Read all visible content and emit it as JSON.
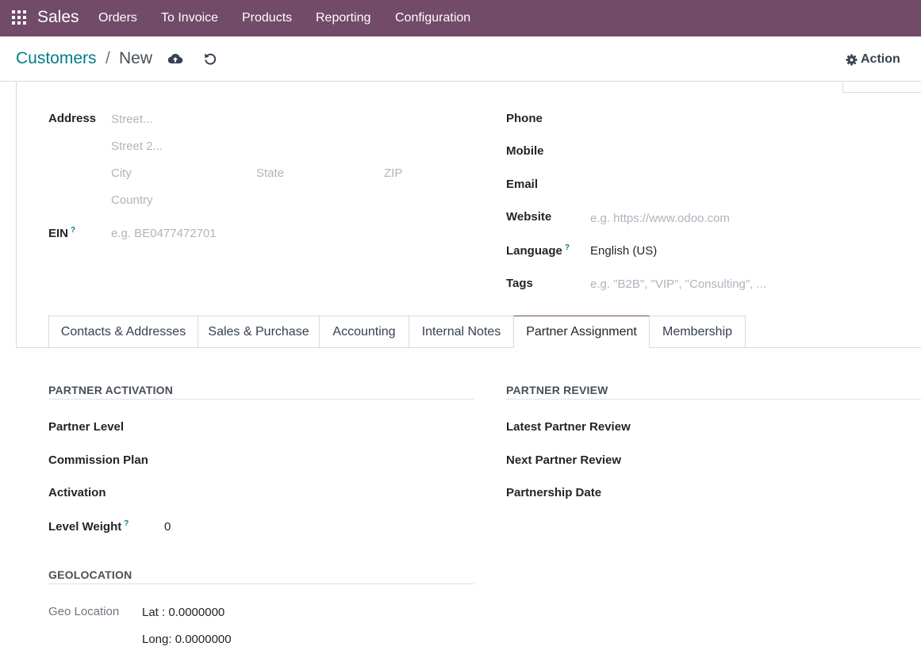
{
  "nav": {
    "app": "Sales",
    "menu": [
      "Orders",
      "To Invoice",
      "Products",
      "Reporting",
      "Configuration"
    ]
  },
  "breadcrumb": {
    "parent": "Customers",
    "separator": "/",
    "current": "New"
  },
  "action_label": "Action",
  "address": {
    "label": "Address",
    "street_ph": "Street...",
    "street2_ph": "Street 2...",
    "city_ph": "City",
    "state_ph": "State",
    "zip_ph": "ZIP",
    "country_ph": "Country"
  },
  "ein": {
    "label": "EIN",
    "help": "?",
    "placeholder": "e.g. BE0477472701"
  },
  "contact": {
    "phone_label": "Phone",
    "mobile_label": "Mobile",
    "email_label": "Email",
    "website_label": "Website",
    "website_ph": "e.g. https://www.odoo.com",
    "language_label": "Language",
    "language_help": "?",
    "language_value": "English (US)",
    "tags_label": "Tags",
    "tags_ph": "e.g. \"B2B\", \"VIP\", \"Consulting\", ..."
  },
  "tabs": [
    {
      "label": "Contacts & Addresses"
    },
    {
      "label": "Sales & Purchase"
    },
    {
      "label": "Accounting"
    },
    {
      "label": "Internal Notes"
    },
    {
      "label": "Partner Assignment"
    },
    {
      "label": "Membership"
    }
  ],
  "active_tab": "Partner Assignment",
  "partner_activation": {
    "title": "PARTNER ACTIVATION",
    "level_label": "Partner Level",
    "commission_label": "Commission Plan",
    "activation_label": "Activation",
    "weight_label": "Level Weight",
    "weight_help": "?",
    "weight_value": "0"
  },
  "partner_review": {
    "title": "PARTNER REVIEW",
    "latest_label": "Latest Partner Review",
    "next_label": "Next Partner Review",
    "date_label": "Partnership Date"
  },
  "geolocation": {
    "title": "GEOLOCATION",
    "label": "Geo Location",
    "lat": "Lat : 0.0000000",
    "long": "Long: 0.0000000"
  },
  "colors": {
    "brand": "#714b67",
    "link": "#017e84"
  }
}
